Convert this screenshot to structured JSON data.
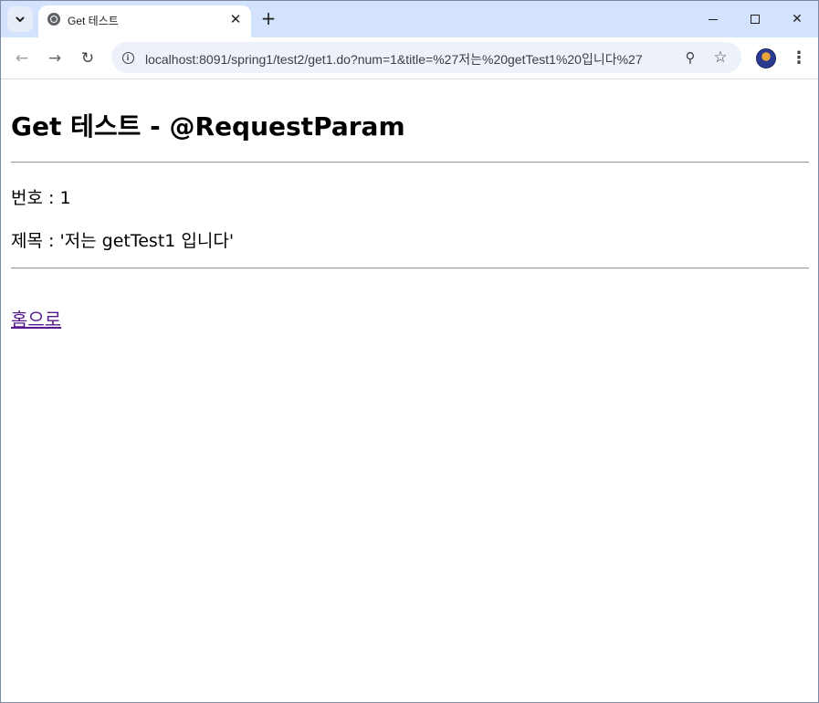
{
  "browser": {
    "tab": {
      "title": "Get 테스트",
      "close_glyph": "✕"
    },
    "new_tab_glyph": "+",
    "window_controls": {
      "close_glyph": "✕"
    },
    "toolbar": {
      "back_glyph": "←",
      "forward_glyph": "→",
      "reload_glyph": "↻",
      "site_info_glyph": "i",
      "url": "localhost:8091/spring1/test2/get1.do?num=1&title=%27저는%20getTest1%20입니다%27",
      "zoom_glyph": "⚲",
      "bookmark_glyph": "☆",
      "menu_glyph": "⋮"
    },
    "icons": {
      "tab_search": "chevron-down-icon",
      "favicon": "globe-icon",
      "back": "arrow-left-icon",
      "forward": "arrow-right-icon",
      "reload": "reload-icon",
      "site_info": "info-icon",
      "zoom": "zoom-icon",
      "bookmark": "star-icon",
      "profile": "avatar",
      "menu": "kebab-menu-icon"
    }
  },
  "page": {
    "heading": "Get 테스트 - @RequestParam",
    "num_line": "번호 : 1",
    "title_line": "제목 : '저는 getTest1 입니다'",
    "home_link": "홈으로",
    "link_color": "#551a8b"
  }
}
